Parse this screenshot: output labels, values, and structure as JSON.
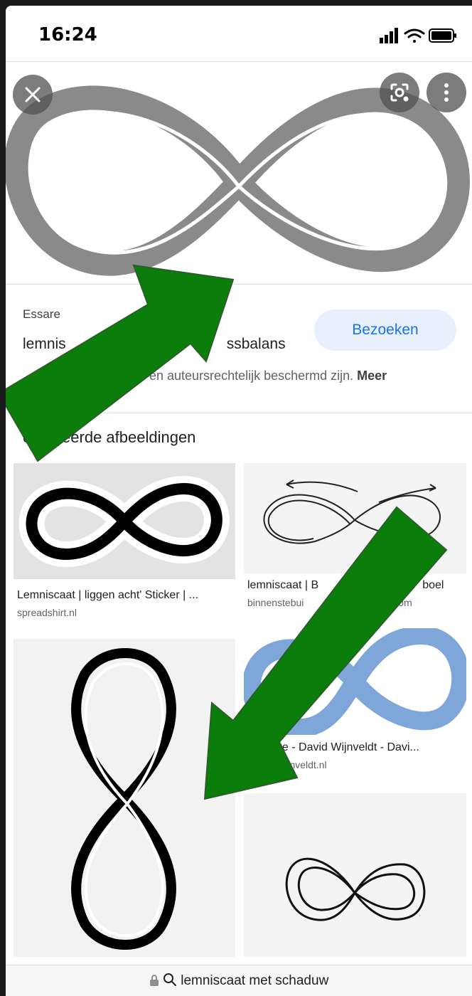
{
  "status_bar": {
    "time": "16:24"
  },
  "viewer": {
    "close_icon": "close-icon",
    "lens_icon": "lens-icon",
    "more_icon": "more-vert-icon"
  },
  "result": {
    "source": "Essare",
    "title_visible_left": "lemnis",
    "title_visible_right": "ssbalans",
    "visit_label": "Bezoeken",
    "copyright_text": "en auteursrechtelijk beschermd zijn.",
    "copyright_more": "Meer"
  },
  "related": {
    "heading": "erelateerde afbeeldingen",
    "items": [
      {
        "title": "Lemniscaat | liggen acht' Sticker | ...",
        "source": "spreadshirt.nl"
      },
      {
        "title_left": "lemniscaat | B",
        "title_right": "boel",
        "source_left": "binnenstebui",
        "source_right": "ss.com"
      },
      {
        "title": "tte - David Wijnveldt - Davi...",
        "source": "lwijnveldt.nl"
      }
    ]
  },
  "url_bar": {
    "text": "lemniscaat met schaduw",
    "lock_icon": "lock-icon",
    "search_icon": "search-icon"
  },
  "colors": {
    "arrow_green": "#0a7d0a",
    "visit_bg": "#e8f0fe",
    "visit_text": "#1a73e8",
    "infinity_gray": "#8a8a8a",
    "infinity_blue": "#7fa6d8"
  }
}
